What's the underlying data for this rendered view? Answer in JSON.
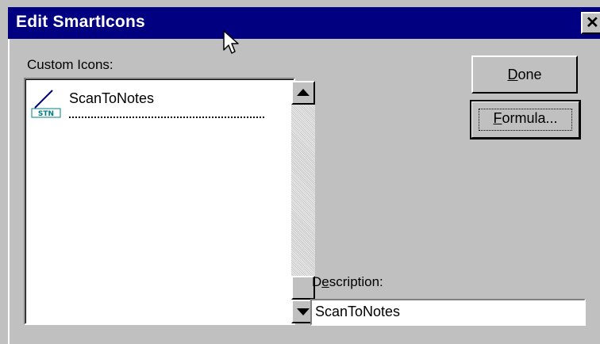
{
  "window": {
    "title": "Edit SmartIcons",
    "close_glyph": "✕"
  },
  "custom_icons": {
    "label": "Custom Icons:",
    "items": [
      {
        "name": "ScanToNotes",
        "icon": "scan-to-notes-icon",
        "icon_badge": "STN"
      }
    ]
  },
  "buttons": {
    "done": {
      "mnemonic": "D",
      "rest": "one"
    },
    "formula": {
      "mnemonic": "F",
      "rest": "ormula..."
    }
  },
  "description": {
    "label_pre": "D",
    "label_mnemonic": "e",
    "label_post": "scription:",
    "value": "ScanToNotes"
  },
  "colors": {
    "titlebar": "#000080",
    "face": "#c0c0c0",
    "window": "#ffffff"
  }
}
